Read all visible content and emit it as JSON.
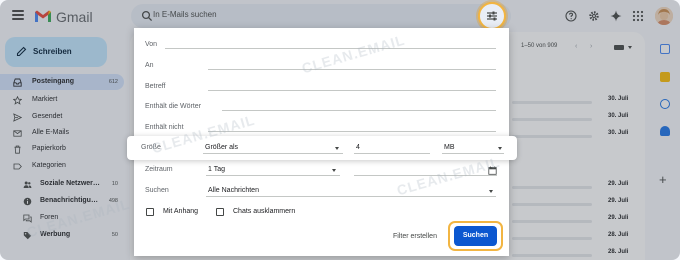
{
  "app": {
    "name": "Gmail"
  },
  "search": {
    "placeholder": "In E-Mails suchen"
  },
  "sidebar": {
    "compose_label": "Schreiben",
    "items": [
      {
        "label": "Posteingang",
        "count": "612",
        "icon": "inbox-icon"
      },
      {
        "label": "Markiert",
        "count": "",
        "icon": "star-icon"
      },
      {
        "label": "Gesendet",
        "count": "",
        "icon": "send-icon"
      },
      {
        "label": "Alle E-Mails",
        "count": "",
        "icon": "mail-icon"
      },
      {
        "label": "Papierkorb",
        "count": "",
        "icon": "trash-icon"
      },
      {
        "label": "Kategorien",
        "count": "",
        "icon": "label-icon"
      },
      {
        "label": "Soziale Netzwer…",
        "count": "10",
        "icon": "people-icon"
      },
      {
        "label": "Benachrichtigu…",
        "count": "498",
        "icon": "info-icon"
      },
      {
        "label": "Foren",
        "count": "",
        "icon": "forum-icon"
      },
      {
        "label": "Werbung",
        "count": "50",
        "icon": "tag-icon"
      }
    ]
  },
  "list": {
    "pager": "1–50 von 909",
    "dates": [
      "30. Juli",
      "30. Juli",
      "30. Juli",
      "29. Juli",
      "29. Juli",
      "29. Juli",
      "28. Juli",
      "28. Juli"
    ]
  },
  "dialog": {
    "from_label": "Von",
    "to_label": "An",
    "subject_label": "Betreff",
    "has_words_label": "Enthält die Wörter",
    "not_has_label": "Enthält nicht",
    "size_label": "Größe",
    "size_operator": "Größer als",
    "size_value": "4",
    "size_unit": "MB",
    "date_within_label": "Zeitraum",
    "date_within_value": "1 Tag",
    "search_in_label": "Suchen",
    "search_in_value": "Alle Nachrichten",
    "has_attachment_label": "Mit Anhang",
    "exclude_chats_label": "Chats ausklammern",
    "create_filter_label": "Filter erstellen",
    "search_button_label": "Suchen"
  },
  "watermark": "CLEAN.EMAIL",
  "colors": {
    "accent": "#0b57d0",
    "highlight": "#f2b542",
    "compose_bg": "#c2e7ff",
    "active_nav_bg": "#d3e3fd"
  }
}
